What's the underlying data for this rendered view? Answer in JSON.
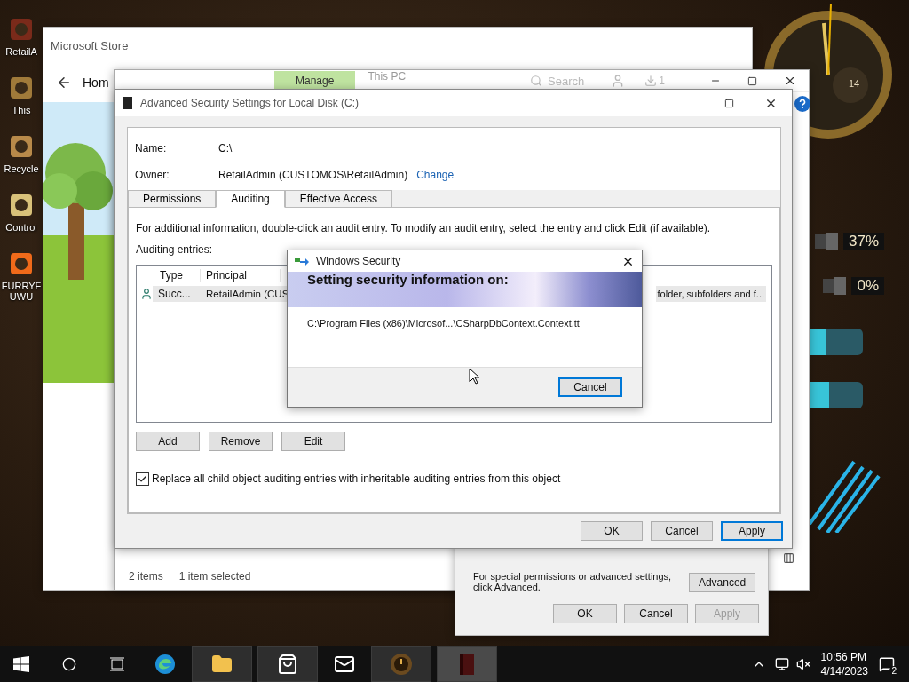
{
  "desktop_icons": [
    {
      "label": "RetailA"
    },
    {
      "label": "This"
    },
    {
      "label": "Recycle"
    },
    {
      "label": "Control"
    },
    {
      "label": "FURRYF UWU"
    }
  ],
  "widgets": {
    "clock_day": "14",
    "gauges": [
      {
        "reading": "37%"
      },
      {
        "reading": "0%"
      }
    ]
  },
  "store_window": {
    "title": "Microsoft Store",
    "nav_text": "Hom"
  },
  "explorer": {
    "ribbon_tab": "Manage",
    "location": "This PC",
    "search_placeholder": "Search",
    "download_count": "1",
    "status_items": "2 items",
    "status_selected": "1 item selected"
  },
  "properties_window": {
    "note_lines": [
      "For special permissions or advanced settings,",
      "click Advanced."
    ],
    "advanced_button": "Advanced",
    "buttons": [
      {
        "label": "OK",
        "disabled": false
      },
      {
        "label": "Cancel",
        "disabled": false
      },
      {
        "label": "Apply",
        "disabled": true
      }
    ]
  },
  "advanced_security": {
    "title": "Advanced Security Settings for Local Disk (C:)",
    "name_label": "Name:",
    "name_value": "C:\\",
    "owner_label": "Owner:",
    "owner_value": "RetailAdmin (CUSTOMOS\\RetailAdmin)",
    "change_link": "Change",
    "tabs": [
      {
        "label": "Permissions",
        "selected": false
      },
      {
        "label": "Auditing",
        "selected": true
      },
      {
        "label": "Effective Access",
        "selected": false
      }
    ],
    "info": "For additional information, double-click an audit entry. To modify an audit entry, select the entry and click Edit (if available).",
    "entries_label": "Auditing entries:",
    "columns": [
      "Type",
      "Principal"
    ],
    "rows": [
      {
        "type": "Succ...",
        "principal": "RetailAdmin (CUS",
        "applies_to": "folder, subfolders and f...",
        "selected": true
      }
    ],
    "list_buttons": [
      "Add",
      "Remove",
      "Edit"
    ],
    "replace_checkbox": {
      "label": "Replace all child object auditing entries with inheritable auditing entries from this object",
      "checked": true
    },
    "footer_buttons": [
      {
        "label": "OK",
        "default": false
      },
      {
        "label": "Cancel",
        "default": false
      },
      {
        "label": "Apply",
        "default": true
      }
    ]
  },
  "security_dialog": {
    "title": "Windows Security",
    "heading": "Setting security information on:",
    "path": "C:\\Program Files (x86)\\Microsof...\\CSharpDbContext.Context.tt",
    "button": "Cancel"
  },
  "taskbar": {
    "apps": [
      {
        "kind": "edge",
        "open": false,
        "selected": false
      },
      {
        "kind": "folder",
        "open": true,
        "selected": false
      },
      {
        "kind": "store",
        "open": true,
        "selected": false
      },
      {
        "kind": "mail",
        "open": false,
        "selected": false
      },
      {
        "kind": "clock",
        "open": true,
        "selected": false
      },
      {
        "kind": "book",
        "open": true,
        "selected": true
      }
    ],
    "time": "10:56 PM",
    "date": "4/14/2023",
    "notification_count": "2"
  }
}
